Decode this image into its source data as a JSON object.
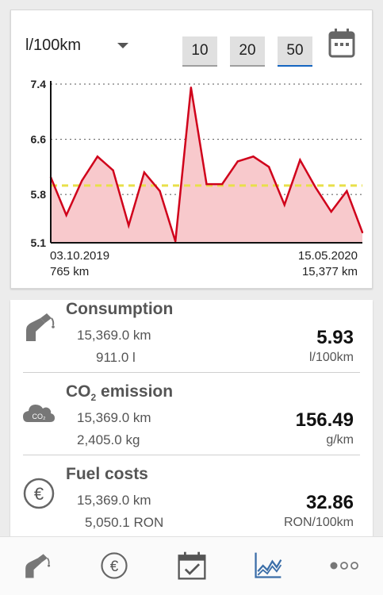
{
  "chart_card": {
    "unit_selector": "l/100km",
    "range_buttons": [
      "10",
      "20",
      "50"
    ],
    "active_range": "50",
    "calendar_icon": "calendar-icon"
  },
  "chart_data": {
    "type": "area",
    "y_ticks": [
      "7.4",
      "6.6",
      "5.8",
      "5.1"
    ],
    "ylim": [
      5.1,
      7.4
    ],
    "average": 5.93,
    "values": [
      6.05,
      5.5,
      6.0,
      6.35,
      6.15,
      5.35,
      6.12,
      5.85,
      5.12,
      7.35,
      5.95,
      5.95,
      6.28,
      6.35,
      6.2,
      5.65,
      6.3,
      5.9,
      5.55,
      5.85,
      5.25
    ],
    "x_start_date": "03.10.2019",
    "x_start_km": "765 km",
    "x_end_date": "15.05.2020",
    "x_end_km": "15,377 km",
    "colors": {
      "line": "#d0021b",
      "fill": "#f8c9cc",
      "average": "#e8e04a",
      "grid": "#555555"
    }
  },
  "stats": [
    {
      "icon": "fuel-pump-icon",
      "title": "Consumption",
      "line1": "15,369.0 km",
      "line2": "911.0 l",
      "value": "5.93",
      "unit": "l/100km"
    },
    {
      "icon": "co2-cloud-icon",
      "title_main": "CO",
      "title_sub": "2",
      "title_rest": " emission",
      "line1": "15,369.0 km",
      "line2": "2,405.0 kg",
      "value": "156.49",
      "unit": "g/km"
    },
    {
      "icon": "euro-icon",
      "title": "Fuel costs",
      "line1": "15,369.0 km",
      "line2": "5,050.1 RON",
      "value": "32.86",
      "unit": "RON/100km"
    }
  ],
  "bottom_nav": [
    "fuel-pump-icon",
    "euro-icon",
    "calendar-check-icon",
    "chart-icon",
    "more-icon"
  ],
  "accent_color": "#1565c0"
}
